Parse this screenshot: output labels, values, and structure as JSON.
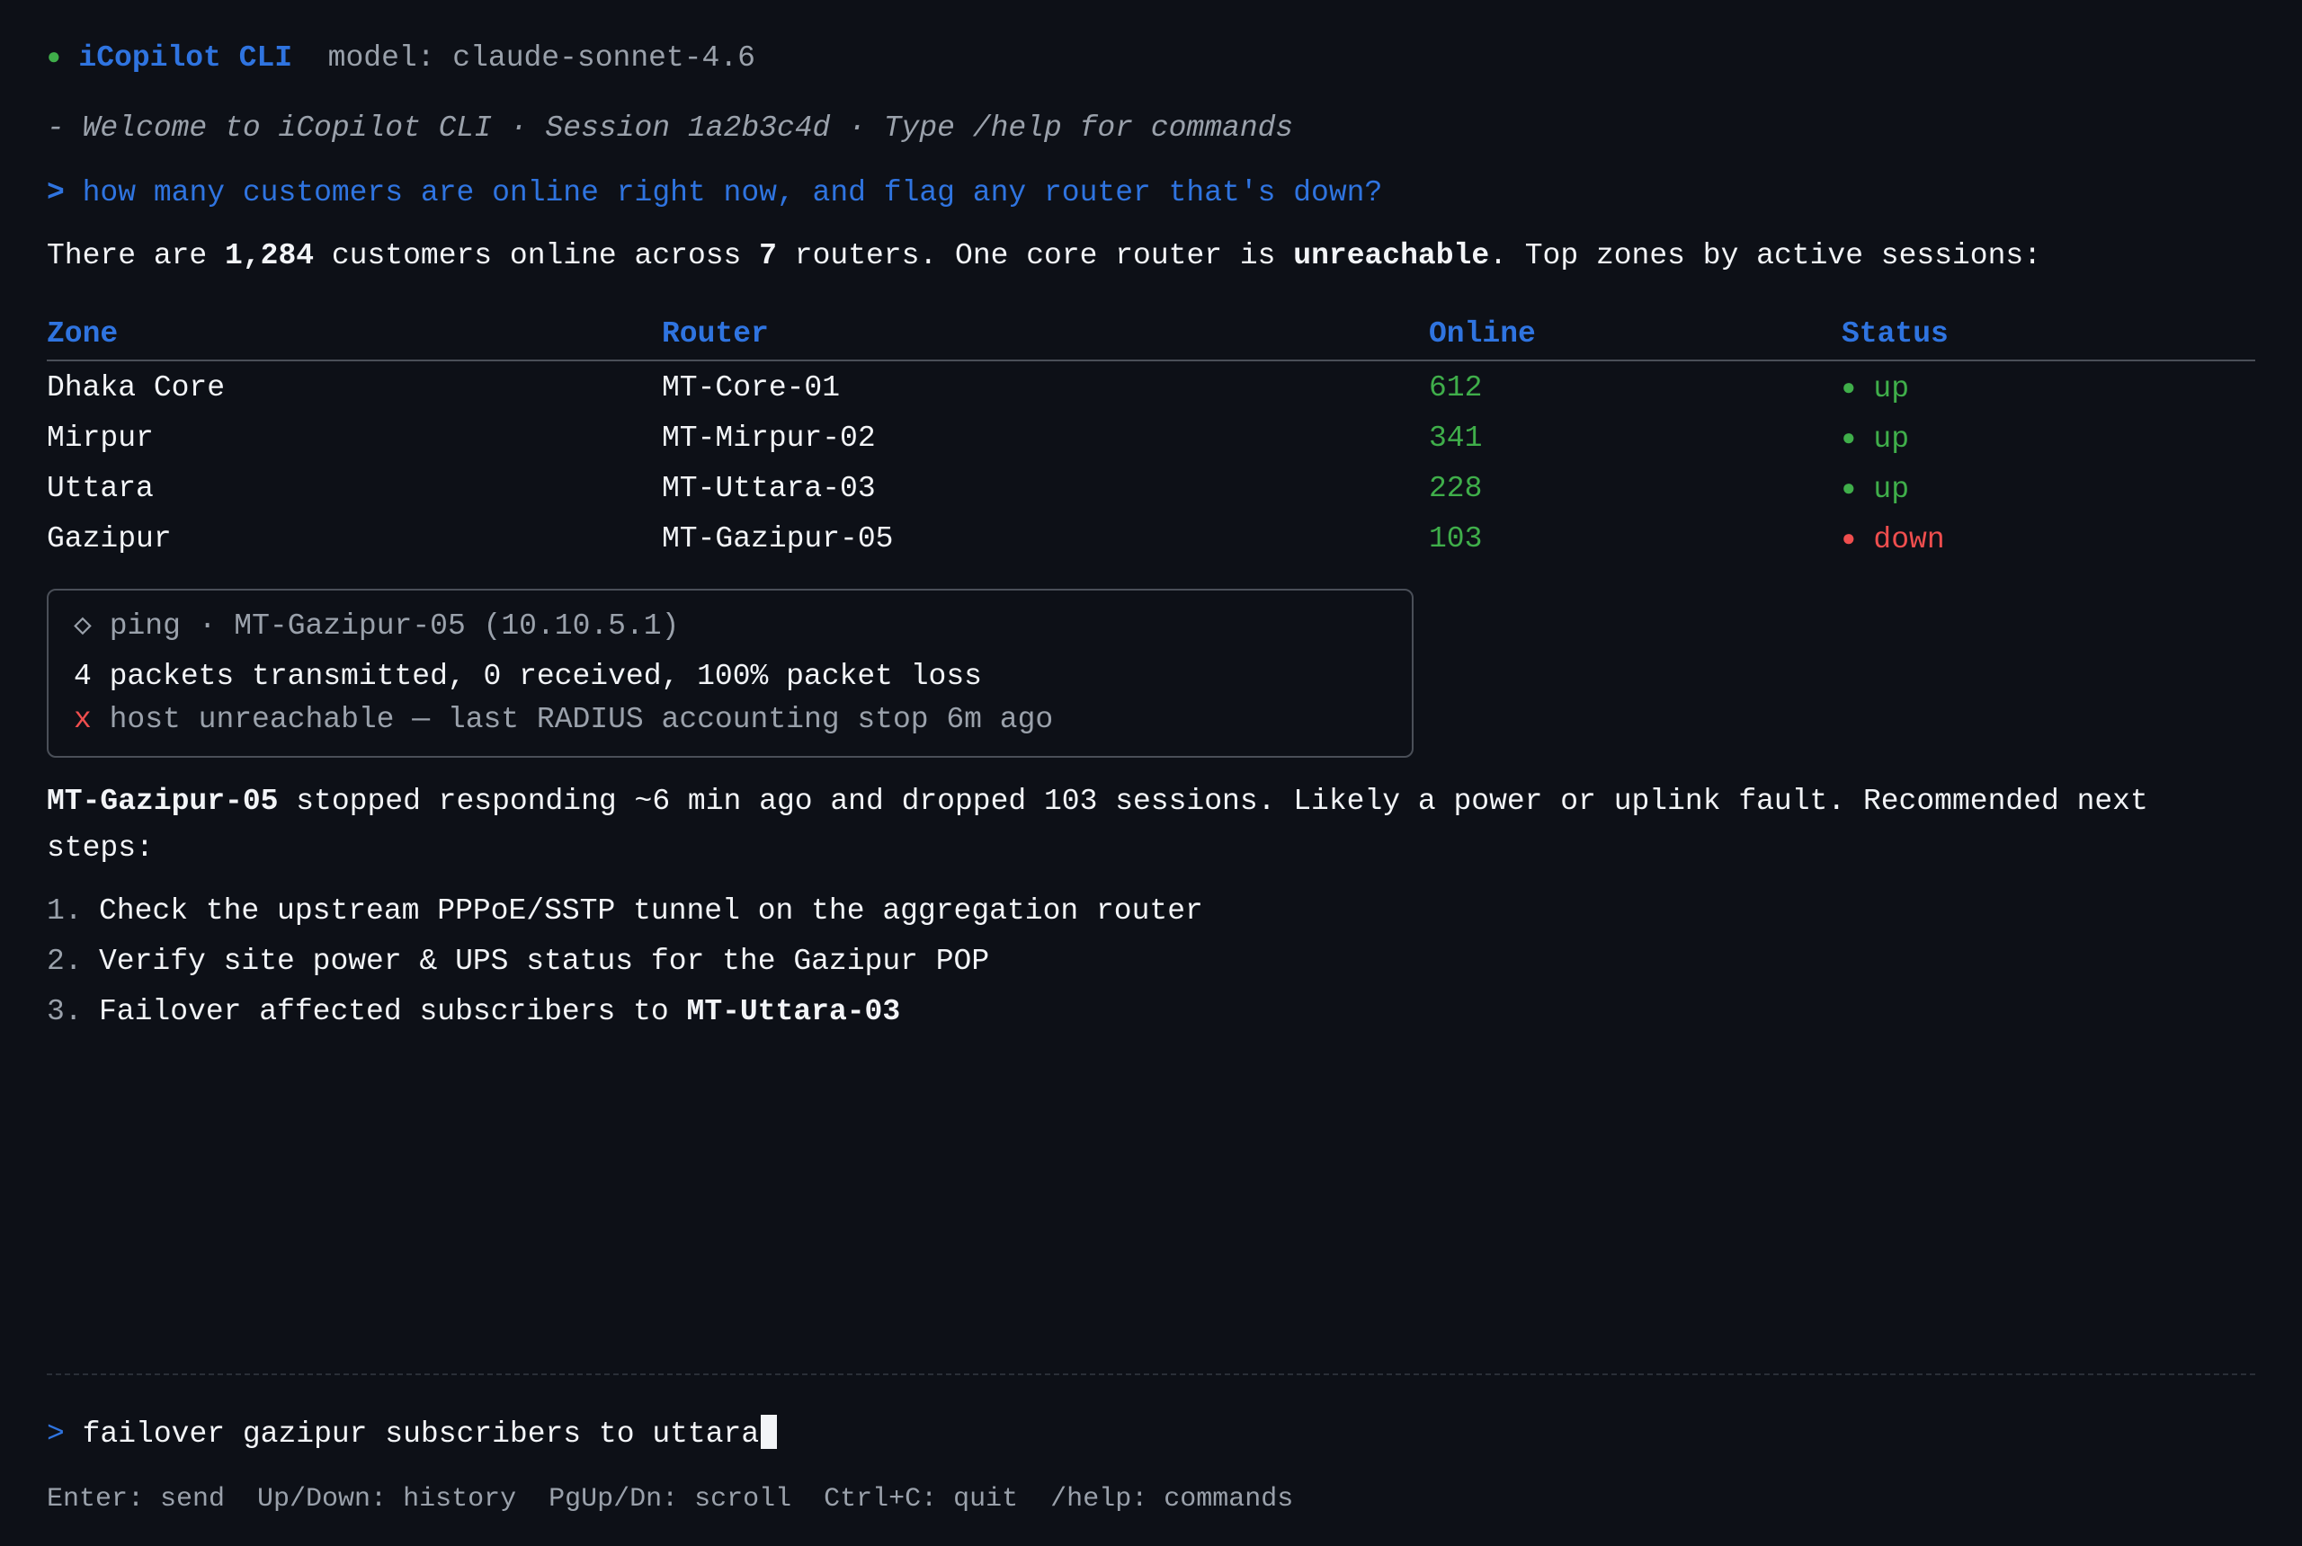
{
  "header": {
    "status_dot": "●",
    "app_name": "iCopilot CLI",
    "model_label": "model: claude-sonnet-4.6"
  },
  "welcome": "- Welcome to iCopilot CLI · Session 1a2b3c4d · Type /help for commands",
  "user_prompt": {
    "caret": ">",
    "text": "how many customers are online right now, and flag any router that's down?"
  },
  "answer": {
    "p1": "There are ",
    "customers": "1,284",
    "p2": " customers online across ",
    "routers": "7",
    "p3": " routers. One core router is ",
    "state": "unreachable",
    "p4": ". Top zones by active sessions:"
  },
  "table": {
    "columns": [
      "Zone",
      "Router",
      "Online",
      "Status"
    ],
    "rows": [
      {
        "zone": "Dhaka Core",
        "router": "MT-Core-01",
        "online": "612",
        "status": "up"
      },
      {
        "zone": "Mirpur",
        "router": "MT-Mirpur-02",
        "online": "341",
        "status": "up"
      },
      {
        "zone": "Uttara",
        "router": "MT-Uttara-03",
        "online": "228",
        "status": "up"
      },
      {
        "zone": "Gazipur",
        "router": "MT-Gazipur-05",
        "online": "103",
        "status": "down"
      }
    ],
    "status_bullet": "●"
  },
  "ping": {
    "icon": "◇",
    "title": "ping · MT-Gazipur-05 (10.10.5.1)",
    "result": "4 packets transmitted, 0 received, 100% packet loss",
    "error_mark": "x",
    "error_text": "host unreachable — last RADIUS accounting stop 6m ago"
  },
  "summary": {
    "router": "MT-Gazipur-05",
    "text": " stopped responding ~6 min ago and dropped 103 sessions. Likely a power or uplink fault. Recommended next steps:"
  },
  "steps": [
    {
      "num": "1.",
      "text": "Check the upstream PPPoE/SSTP tunnel on the aggregation router",
      "bold": ""
    },
    {
      "num": "2.",
      "text": "Verify site power & UPS status for the Gazipur POP",
      "bold": ""
    },
    {
      "num": "3.",
      "text": "Failover affected subscribers to ",
      "bold": "MT-Uttara-03"
    }
  ],
  "input": {
    "caret": ">",
    "value": "failover gazipur subscribers to uttara"
  },
  "footer": "Enter: send  Up/Down: history  PgUp/Dn: scroll  Ctrl+C: quit  /help: commands",
  "colors": {
    "background": "#0d1017",
    "accent": "#2f74e0",
    "up": "#3fae4a",
    "down": "#ef4e4e",
    "muted": "#9aa1ab",
    "text": "#f2f4f7"
  }
}
